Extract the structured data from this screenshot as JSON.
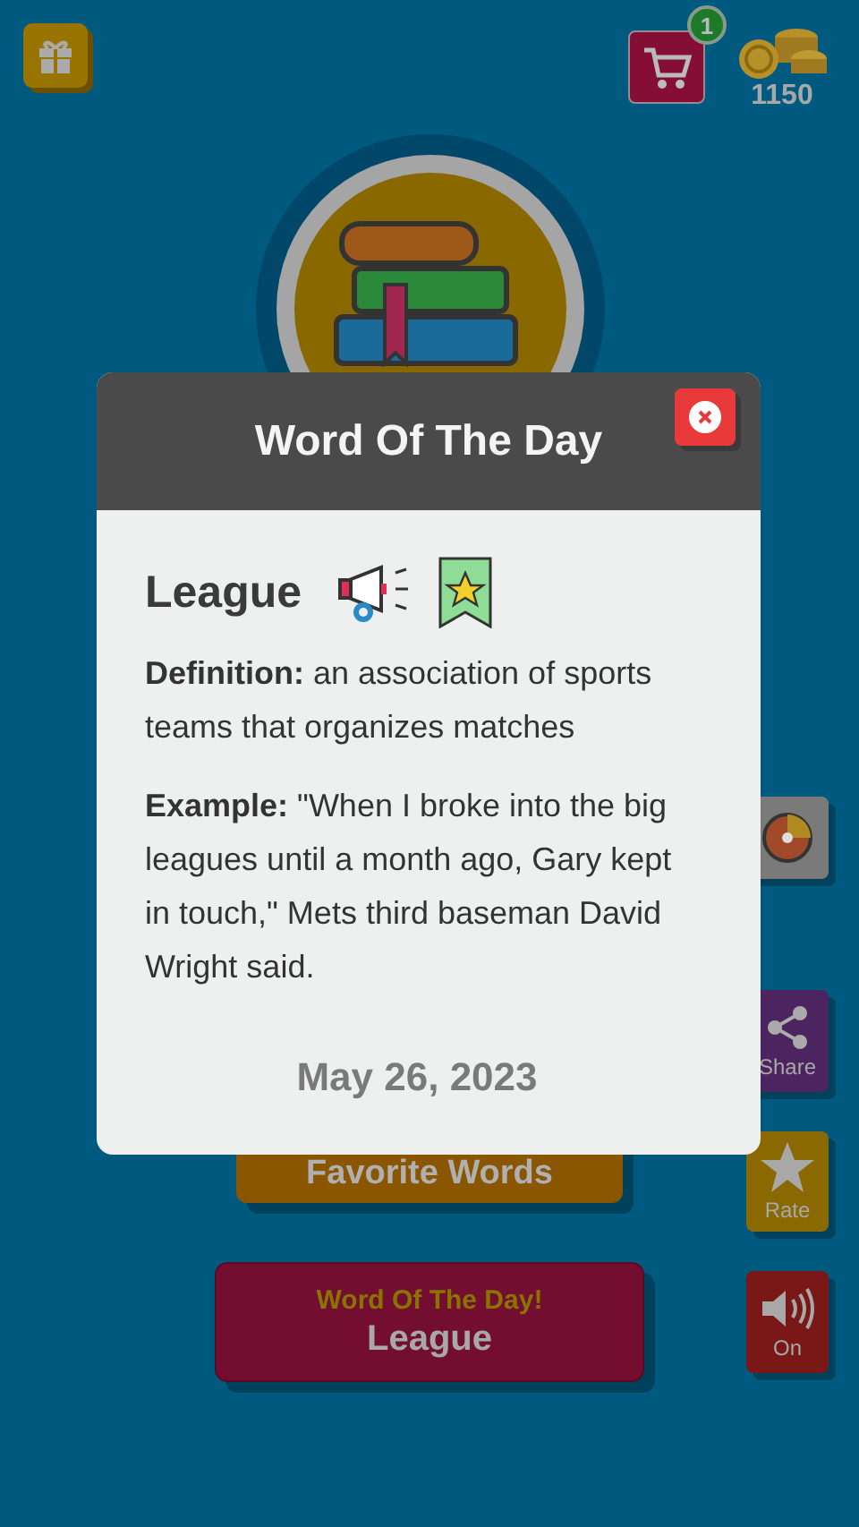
{
  "header": {
    "cart_badge": "1",
    "coins": "1150"
  },
  "favorites_button": {
    "label": "Favorite Words"
  },
  "word_button": {
    "title": "Word Of The Day!",
    "label": "League"
  },
  "side_buttons": [
    {
      "kind": "wheel"
    },
    {
      "kind": "share",
      "label": "Share"
    },
    {
      "kind": "rate",
      "label": "Rate"
    },
    {
      "kind": "sound",
      "label": "On"
    }
  ],
  "dialog": {
    "title": "Word Of The Day",
    "word": "League",
    "definition": "**Definition:** an association of sports teams that organizes matches",
    "example": "**Example:** \"When I broke into the big leagues until a month ago, Gary kept in touch,\" Mets third baseman David Wright said.",
    "date": "May 26, 2023"
  }
}
